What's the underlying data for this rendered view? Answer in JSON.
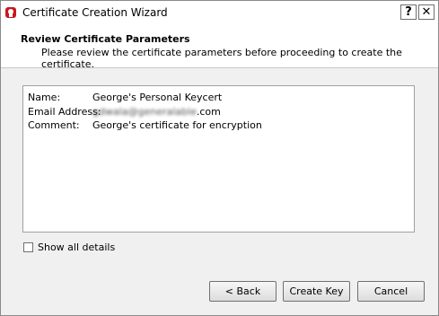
{
  "window": {
    "title": "Certificate Creation Wizard",
    "help_label": "?",
    "close_label": "✕"
  },
  "header": {
    "title": "Review Certificate Parameters",
    "description": "Please review the certificate parameters before proceeding to create the certificate."
  },
  "details": {
    "name_label": "Name:",
    "name_value": "George's Personal Keycert",
    "email_label": "Email Address:",
    "email_value_obscured": "gdwala@generalable",
    "email_value_suffix": ".com",
    "comment_label": "Comment:",
    "comment_value": "George's certificate for encryption"
  },
  "options": {
    "show_all_details_label": "Show all details",
    "show_all_details_checked": false
  },
  "buttons": {
    "back_label": "< Back",
    "create_label": "Create Key",
    "cancel_label": "Cancel"
  },
  "icons": {
    "app_icon": "certificate-app-icon"
  }
}
